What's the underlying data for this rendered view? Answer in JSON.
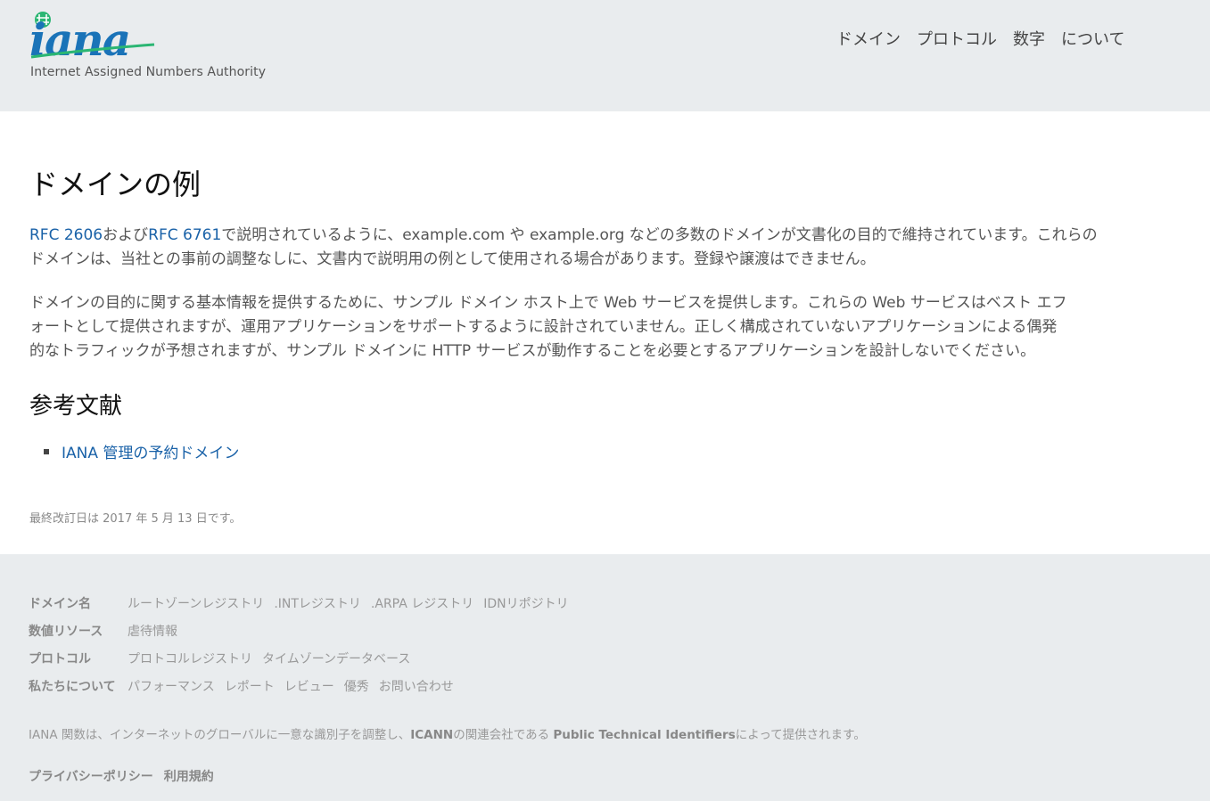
{
  "header": {
    "logo_text": "iana",
    "logo_subtitle": "Internet Assigned Numbers Authority",
    "nav": [
      "ドメイン",
      "プロトコル",
      "数字",
      "について"
    ]
  },
  "main": {
    "title": "ドメインの例",
    "p1": {
      "rfc1": "RFC 2606",
      "and": "および",
      "rfc2": "RFC 6761",
      "line1_rest": "で説明されているように、example.com や example.org などの多数のドメインが文書化の目的で維持されています。これらの",
      "line2": "ドメインは、当社との事前の調整なしに、文書内で説明用の例として使用される場合があります。登録や譲渡はできません。"
    },
    "p2": {
      "line1": "ドメインの目的に関する基本情報を提供するために、サンプル ドメイン ホスト上で Web サービスを提供します。これらの Web サービスはベスト エフ",
      "line2": "ォートとして提供されますが、運用アプリケーションをサポートするように設計されていません。正しく構成されていないアプリケーションによる偶発",
      "line3": "的なトラフィックが予想されますが、サンプル ドメインに HTTP サービスが動作することを必要とするアプリケーションを設計しないでください。"
    },
    "refs_title": "参考文献",
    "refs": [
      "IANA 管理の予約ドメイン"
    ],
    "updated": "最終改訂日は 2017 年 5 月 13 日です。"
  },
  "footer": {
    "rows": [
      {
        "label": "ドメイン名",
        "links": [
          "ルートゾーンレジストリ",
          ".INTレジストリ",
          ".ARPA レジストリ",
          "IDNリポジトリ"
        ]
      },
      {
        "label": "数値リソース",
        "links": [
          "虐待情報"
        ]
      },
      {
        "label": "プロトコル",
        "links": [
          "プロトコルレジストリ",
          "タイムゾーンデータベース"
        ]
      },
      {
        "label": "私たちについて",
        "links": [
          "パフォーマンス",
          "レポート",
          "レビュー",
          "優秀",
          "お問い合わせ"
        ]
      }
    ],
    "note": {
      "part1": "IANA 関数は、インターネットのグローバルに一意な識別子を調整し、",
      "icann": "ICANN",
      "part2": "の関連会社である ",
      "pti": "Public Technical Identifiers",
      "part3": "によって提供されます。"
    },
    "legal": [
      "プライバシーポリシー",
      "利用規約"
    ]
  },
  "colors": {
    "link": "#1a62a8",
    "logo_blue": "#1a73b8",
    "logo_green": "#2bb673",
    "header_bg": "#e9ecee"
  }
}
